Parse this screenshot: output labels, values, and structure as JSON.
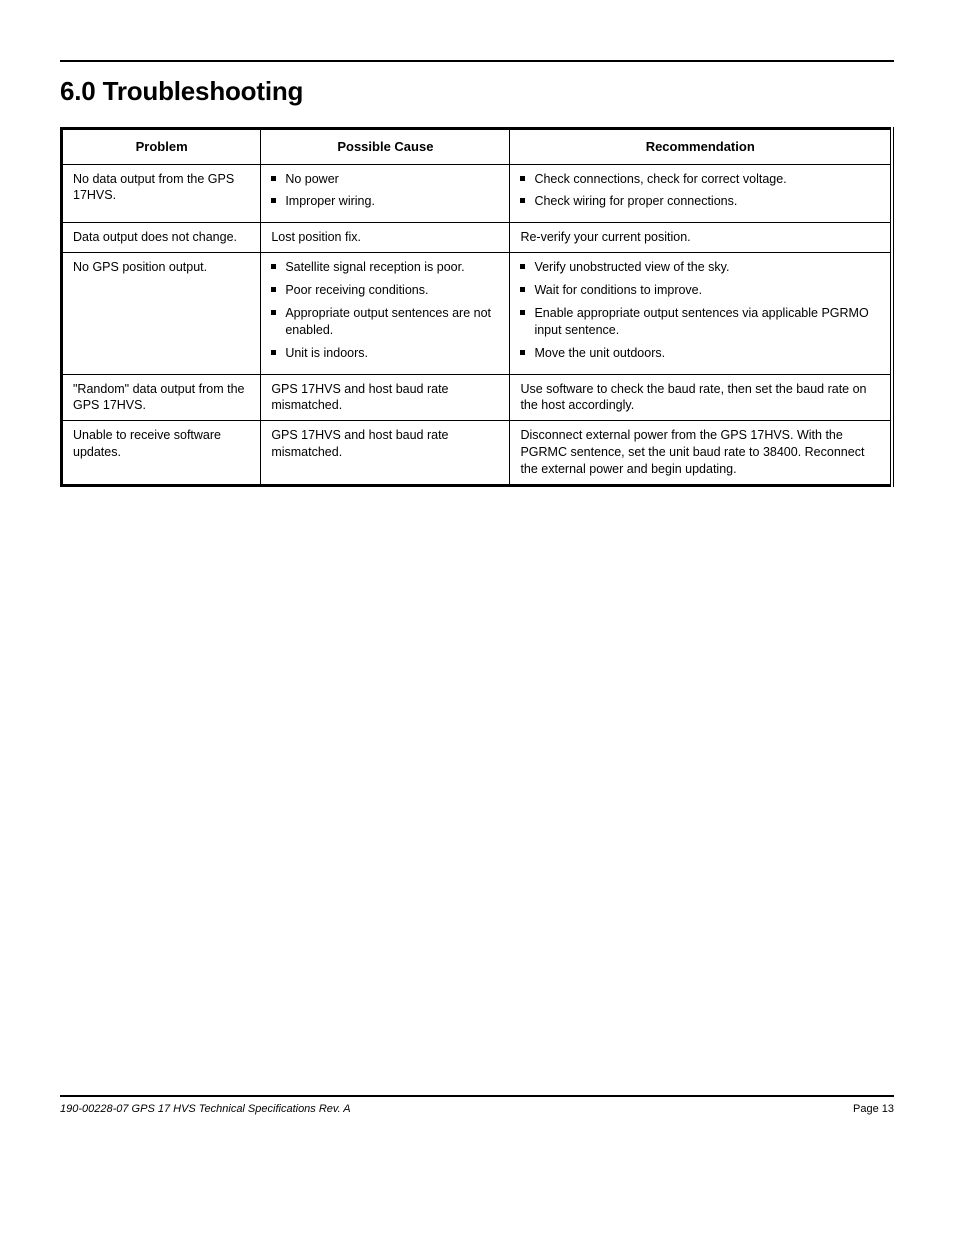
{
  "header": {
    "section_title": "6.0 Troubleshooting"
  },
  "table": {
    "headers": {
      "problem": "Problem",
      "cause": "Possible Cause",
      "rec": "Recommendation"
    },
    "rows": [
      {
        "problem": "No data output from the GPS 17HVS.",
        "causes": [
          "No power",
          "Improper wiring."
        ],
        "recs": [
          "Check connections, check for correct voltage.",
          "Check wiring for proper connections."
        ]
      },
      {
        "problem": "Data output does not change.",
        "causes": [
          "Lost position fix."
        ],
        "recs": [
          "Re-verify your current position."
        ]
      },
      {
        "problem": "No GPS position output.",
        "causes": [
          "Satellite signal reception is poor.",
          "Poor receiving conditions.",
          "Appropriate output sentences are not enabled.",
          "Unit is indoors."
        ],
        "recs": [
          "Verify unobstructed view of the sky.",
          "Wait for conditions to improve.",
          "Enable appropriate output sentences via applicable PGRMO input sentence.",
          "Move the unit outdoors."
        ]
      },
      {
        "problem": "\"Random\" data output from the GPS 17HVS.",
        "causes": [
          "GPS 17HVS and host baud rate mismatched."
        ],
        "recs": [
          "Use software to check the baud rate, then set the baud rate on the host accordingly."
        ]
      },
      {
        "problem": "Unable to receive software updates.",
        "causes": [
          "GPS 17HVS and host baud rate mismatched."
        ],
        "recs": [
          "Disconnect external power from the GPS 17HVS. With the PGRMC sentence, set the unit baud rate to 38400. Reconnect the external power and begin updating."
        ]
      }
    ]
  },
  "footer": {
    "page_info": "190-00228-07         GPS 17 HVS Technical Specifications         Rev. A",
    "page_num": "Page 13"
  }
}
